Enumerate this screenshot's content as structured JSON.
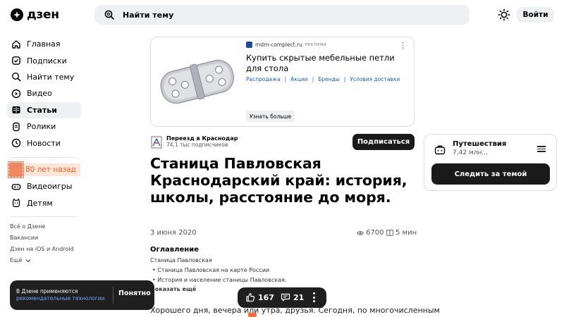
{
  "header": {
    "logo_text": "дзен",
    "search_placeholder": "Найти тему",
    "login_label": "Войти"
  },
  "sidebar": {
    "items": [
      {
        "label": "Главная",
        "icon": "home-icon"
      },
      {
        "label": "Подписки",
        "icon": "subscriptions-icon"
      },
      {
        "label": "Найти тему",
        "icon": "find-topic-icon"
      },
      {
        "label": "Видео",
        "icon": "video-icon"
      },
      {
        "label": "Статьи",
        "icon": "articles-icon",
        "active": true
      },
      {
        "label": "Ролики",
        "icon": "shorts-icon"
      },
      {
        "label": "Новости",
        "icon": "news-icon"
      }
    ],
    "promo_label": "80 лет назад",
    "extra_items": [
      {
        "label": "Видеоигры",
        "icon": "gamepad-icon"
      },
      {
        "label": "Детям",
        "icon": "kids-icon"
      }
    ],
    "footer_links": [
      "Всё о Дзене",
      "Вакансии",
      "Дзен на iOS и Android",
      "Ещё"
    ]
  },
  "ad": {
    "domain": "mdm-complect.ru",
    "tag": "РЕКЛАМА",
    "title": "Купить скрытые мебельные петли для стола",
    "links": [
      "Распродажа",
      "Акции",
      "Бренды",
      "Условия доставки"
    ],
    "cta": "Узнать больше"
  },
  "channel": {
    "name": "Переезд в Краснодар",
    "subscribers": "74,1 тыс подписчиков",
    "subscribe_label": "Подписаться"
  },
  "article": {
    "title": "Станица Павловская Краснодарский край: история, школы, расстояние до моря.",
    "date": "3 июня 2020",
    "views": "6700",
    "read_time": "5 мин",
    "toc_heading": "Оглавление",
    "toc_items": [
      "Станица Павловская",
      "• Станица Павловская на карте России",
      "• История и население станицы Павловская."
    ],
    "show_more": "Показать ещё",
    "body_start": "Хорошего дня, вечера или утра, друзья. Сегодня, по многочисленным"
  },
  "topic_card": {
    "name": "Путешествия",
    "count": "7,42 млн...",
    "follow_label": "Следить за темой"
  },
  "cookie_toast": {
    "text": "В Дзене применяются",
    "link": "рекомендательные технологии",
    "button": "Понятно"
  },
  "reactions": {
    "likes": "167",
    "comments": "21"
  },
  "colors": {
    "accent_orange": "#ff5a1f",
    "button_dark": "#1a1a1a",
    "link_blue": "#1f5fbf",
    "surface_gray": "#eef0f3"
  }
}
